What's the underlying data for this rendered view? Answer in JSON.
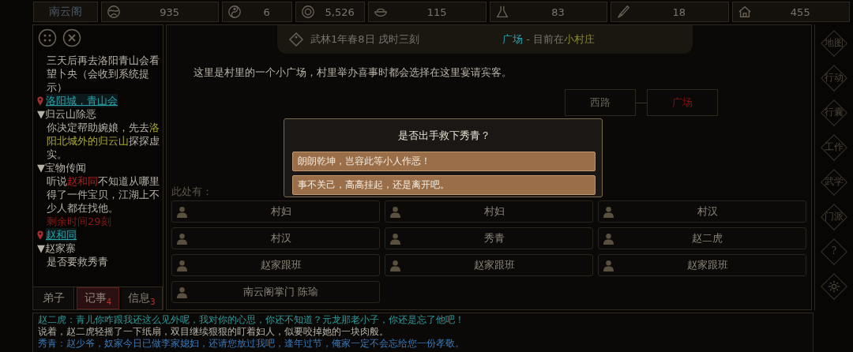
{
  "top_bar": {
    "sect": "南云阁",
    "stats": [
      {
        "kind": "globe",
        "value": "935"
      },
      {
        "kind": "yinyang",
        "value": "6"
      },
      {
        "kind": "coin",
        "value": "5,526"
      },
      {
        "kind": "bowl",
        "value": "115"
      },
      {
        "kind": "flask",
        "value": "83"
      },
      {
        "kind": "brush",
        "value": "18"
      },
      {
        "kind": "house",
        "value": "455"
      }
    ]
  },
  "quest_log": {
    "entries": [
      {
        "kind": "text",
        "segments": [
          {
            "kind": "plain",
            "text": "三天后再去洛阳青山会看望卜央（会收到系统提示）"
          }
        ]
      },
      {
        "kind": "location",
        "segments": [
          {
            "kind": "link",
            "text": "洛阳城，青山会"
          }
        ]
      },
      {
        "kind": "heading",
        "segments": [
          {
            "kind": "plain",
            "text": "▼归云山除恶"
          }
        ]
      },
      {
        "kind": "text",
        "segments": [
          {
            "kind": "plain",
            "text": "你决定帮助婉娘，先去"
          },
          {
            "kind": "place",
            "text": "洛阳北城外的归云山"
          },
          {
            "kind": "plain",
            "text": "探探虚实。"
          }
        ]
      },
      {
        "kind": "heading",
        "segments": [
          {
            "kind": "plain",
            "text": "▼宝物传闻"
          }
        ]
      },
      {
        "kind": "text",
        "segments": [
          {
            "kind": "plain",
            "text": "听说"
          },
          {
            "kind": "person",
            "text": "赵和同"
          },
          {
            "kind": "plain",
            "text": "不知道从哪里得了一件宝贝，江湖上不少人都在找他。"
          }
        ]
      },
      {
        "kind": "timer",
        "segments": [
          {
            "kind": "alert",
            "text": "剩余时间29刻"
          }
        ]
      },
      {
        "kind": "location",
        "segments": [
          {
            "kind": "link",
            "text": "赵和同"
          }
        ]
      },
      {
        "kind": "heading",
        "segments": [
          {
            "kind": "plain",
            "text": "▼赵家寨"
          }
        ]
      },
      {
        "kind": "text",
        "segments": [
          {
            "kind": "plain",
            "text": "是否要救秀青"
          }
        ]
      }
    ]
  },
  "left_tabs": [
    {
      "label": "弟子",
      "selected": false
    },
    {
      "label": "记事",
      "selected": true,
      "badge": "4"
    },
    {
      "label": "信息",
      "selected": false,
      "badge": "3"
    }
  ],
  "header": {
    "date": "武林1年春8日 戌时三刻",
    "place": "广场",
    "separator": " - 目前在",
    "area": "小村庄"
  },
  "description": "这里是村里的一个小广场，村里举办喜事时都会选择在这里宴请宾客。",
  "map_nodes": [
    {
      "label": "西路",
      "selected": false
    },
    {
      "label": "广场",
      "selected": true
    }
  ],
  "people_label": "此处有：",
  "people": [
    "村妇",
    "村妇",
    "村汉",
    "村汉",
    "秀青",
    "赵二虎",
    "赵家跟班",
    "赵家跟班",
    "赵家跟班",
    "南云阁掌门 陈瑜"
  ],
  "dialog": {
    "title": "是否出手救下秀青？",
    "options": [
      "朗朗乾坤，岂容此等小人作恶！",
      "事不关己，高高挂起，还是离开吧。"
    ]
  },
  "side_menu": [
    {
      "kind": "text",
      "label": "地图"
    },
    {
      "kind": "text",
      "label": "行动"
    },
    {
      "kind": "text",
      "label": "行囊"
    },
    {
      "kind": "text",
      "label": "工作"
    },
    {
      "kind": "text",
      "label": "武学"
    },
    {
      "kind": "text",
      "label": "门派"
    },
    {
      "kind": "text",
      "label": "?"
    },
    {
      "kind": "gear"
    }
  ],
  "message_log": [
    {
      "kind": "speech",
      "text": "赵二虎：青儿你咋跟我还这么见外呢，我对你的心思，你还不知道？元龙那老小子，你还是忘了他吧！"
    },
    {
      "kind": "narration",
      "text": "说着，赵二虎轻摇了一下纸扇，双目继续狠狠的盯着妇人，似要咬掉她的一块肉般。"
    },
    {
      "kind": "speech2",
      "text": "秀青：赵少爷，奴家今日已做李家媳妇，还请您放过我吧，逢年过节，俺家一定不会忘给您一份孝敬。"
    }
  ]
}
